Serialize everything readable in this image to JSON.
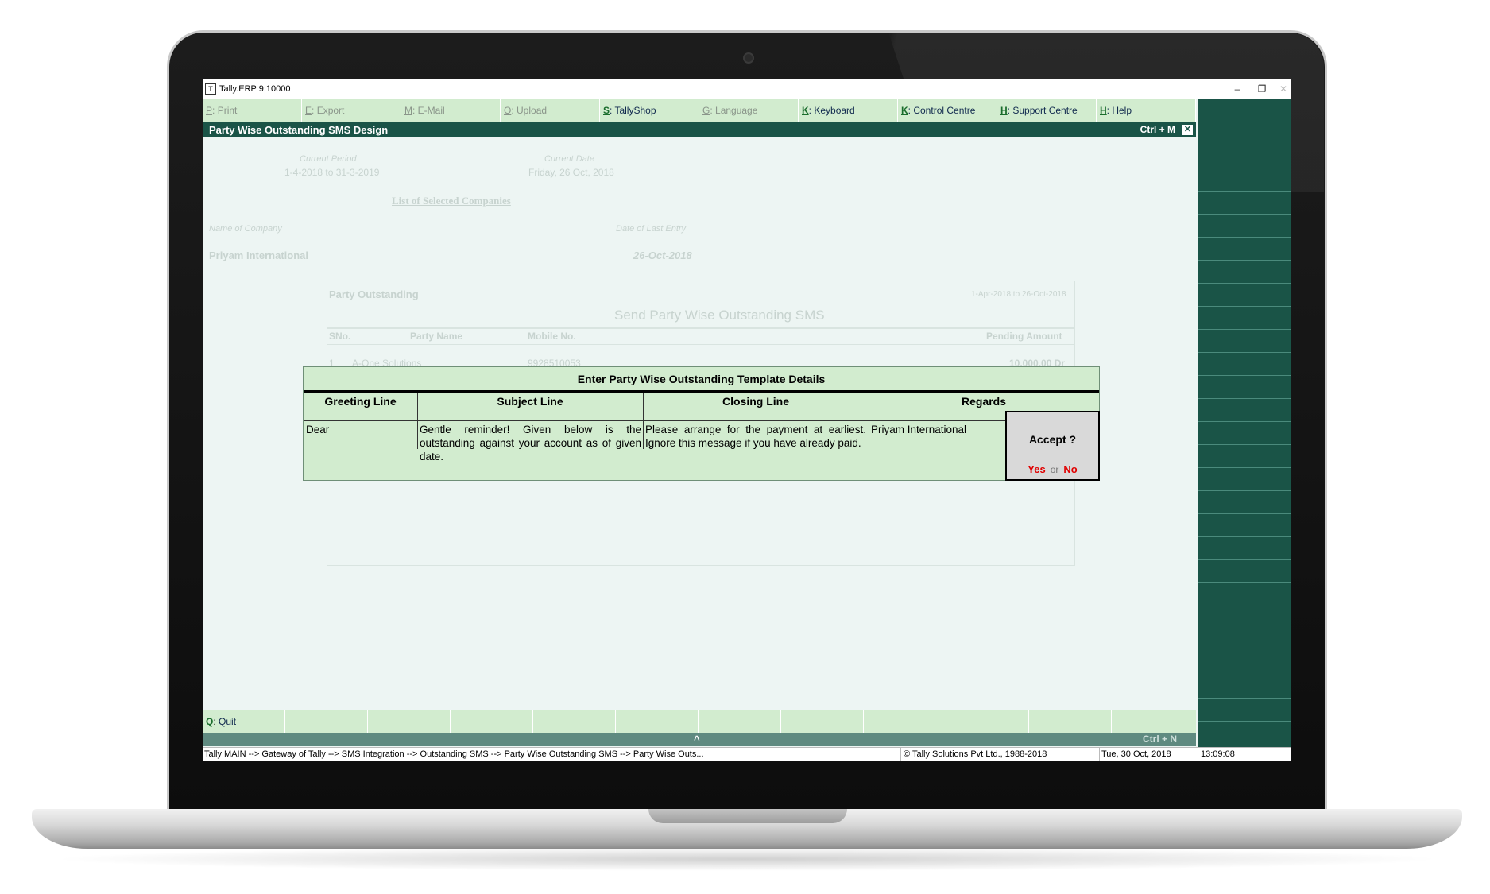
{
  "window": {
    "title": "Tally.ERP 9:10000",
    "logo": "T",
    "minimize": "–",
    "restore": "❐",
    "close": "✕"
  },
  "buttonbar": [
    {
      "key": "P",
      "label": "Print",
      "active": false
    },
    {
      "key": "E",
      "label": "Export",
      "active": false
    },
    {
      "key": "M",
      "label": "E-Mail",
      "active": false
    },
    {
      "key": "O",
      "label": "Upload",
      "active": false
    },
    {
      "key": "S",
      "label": "TallyShop",
      "active": true
    },
    {
      "key": "G",
      "label": "Language",
      "active": false
    },
    {
      "key": "K",
      "label": "Keyboard",
      "active": true
    },
    {
      "key": "K",
      "label": "Control Centre",
      "active": true
    },
    {
      "key": "H",
      "label": "Support Centre",
      "active": true
    },
    {
      "key": "H",
      "label": "Help",
      "active": true
    }
  ],
  "header": {
    "title": "Party Wise Outstanding SMS  Design",
    "shortcut": "Ctrl + M",
    "close": "✕"
  },
  "background": {
    "current_period_label": "Current Period",
    "current_period_value": "1-4-2018 to 31-3-2019",
    "current_date_label": "Current Date",
    "current_date_value": "Friday, 26 Oct, 2018",
    "list_title": "List of Selected Companies",
    "name_of_company_label": "Name of Company",
    "date_last_entry_label": "Date of Last Entry",
    "company_name": "Priyam International",
    "last_entry_date": "26-Oct-2018",
    "report_title": "Party Outstanding",
    "report_period": "1-Apr-2018 to 26-Oct-2018",
    "report_subtitle": "Send Party Wise Outstanding SMS",
    "col_sno": "SNo.",
    "col_party": "Party Name",
    "col_mobile": "Mobile No.",
    "col_pending": "Pending Amount",
    "row1_sno": "1",
    "row1_party": "A-One Solutions",
    "row1_mobile": "9928510053",
    "row1_amount": "10,000.00 Dr"
  },
  "dialog": {
    "title": "Enter Party Wise Outstanding Template Details",
    "headers": {
      "greeting": "Greeting Line",
      "subject": "Subject Line",
      "closing": "Closing Line",
      "regards": "Regards"
    },
    "values": {
      "greeting": "Dear",
      "subject": "Gentle reminder! Given below is the outstanding against your account as of given date.",
      "closing": "Please arrange for the payment at earliest. Ignore this message if you have already paid.",
      "regards": "Priyam International"
    },
    "accept": {
      "question": "Accept ?",
      "yes": "Yes",
      "or": "or",
      "no": "No"
    }
  },
  "bottombar": {
    "quit_key": "Q",
    "quit_label": "Quit"
  },
  "bottomstrip": {
    "caret": "^",
    "shortcut": "Ctrl + N"
  },
  "statusbar": {
    "path": "Tally MAIN --> Gateway of Tally --> SMS Integration --> Outstanding SMS  --> Party Wise Outstanding SMS --> Party Wise Outs...",
    "copyright": "© Tally Solutions Pvt Ltd., 1988-2018",
    "date": "Tue, 30 Oct, 2018",
    "time": "13:09:08"
  },
  "colors": {
    "header_bg": "#1a5447",
    "buttonbar_bg": "#d2eccf",
    "screen_bg": "#edf5f3",
    "accept_yes_no": "#e00000"
  }
}
